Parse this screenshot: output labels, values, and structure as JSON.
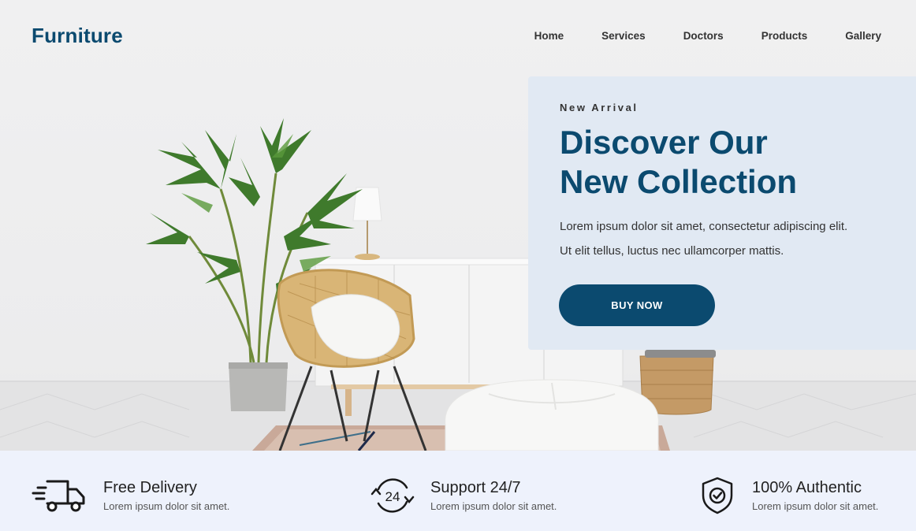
{
  "header": {
    "logo": "Furniture",
    "nav": [
      "Home",
      "Services",
      "Doctors",
      "Products",
      "Gallery"
    ]
  },
  "hero": {
    "eyebrow": "New Arrival",
    "headline_line1": "Discover Our",
    "headline_line2": "New Collection",
    "desc_line1": "Lorem ipsum dolor sit amet, consectetur adipiscing elit.",
    "desc_line2": "Ut elit tellus, luctus nec ullamcorper mattis.",
    "cta": "BUY NOW"
  },
  "features": [
    {
      "icon": "delivery-truck-icon",
      "title": "Free Delivery",
      "subtitle": "Lorem ipsum dolor sit amet."
    },
    {
      "icon": "support-24-7-icon",
      "title": "Support 24/7",
      "subtitle": "Lorem ipsum dolor sit amet."
    },
    {
      "icon": "shield-check-icon",
      "title": "100% Authentic",
      "subtitle": "Lorem ipsum dolor sit amet."
    }
  ],
  "colors": {
    "brand": "#0b4a6f",
    "promo_card": "#e1e9f3",
    "features_bar": "#eef2fc",
    "page_bg": "#efeff0"
  }
}
